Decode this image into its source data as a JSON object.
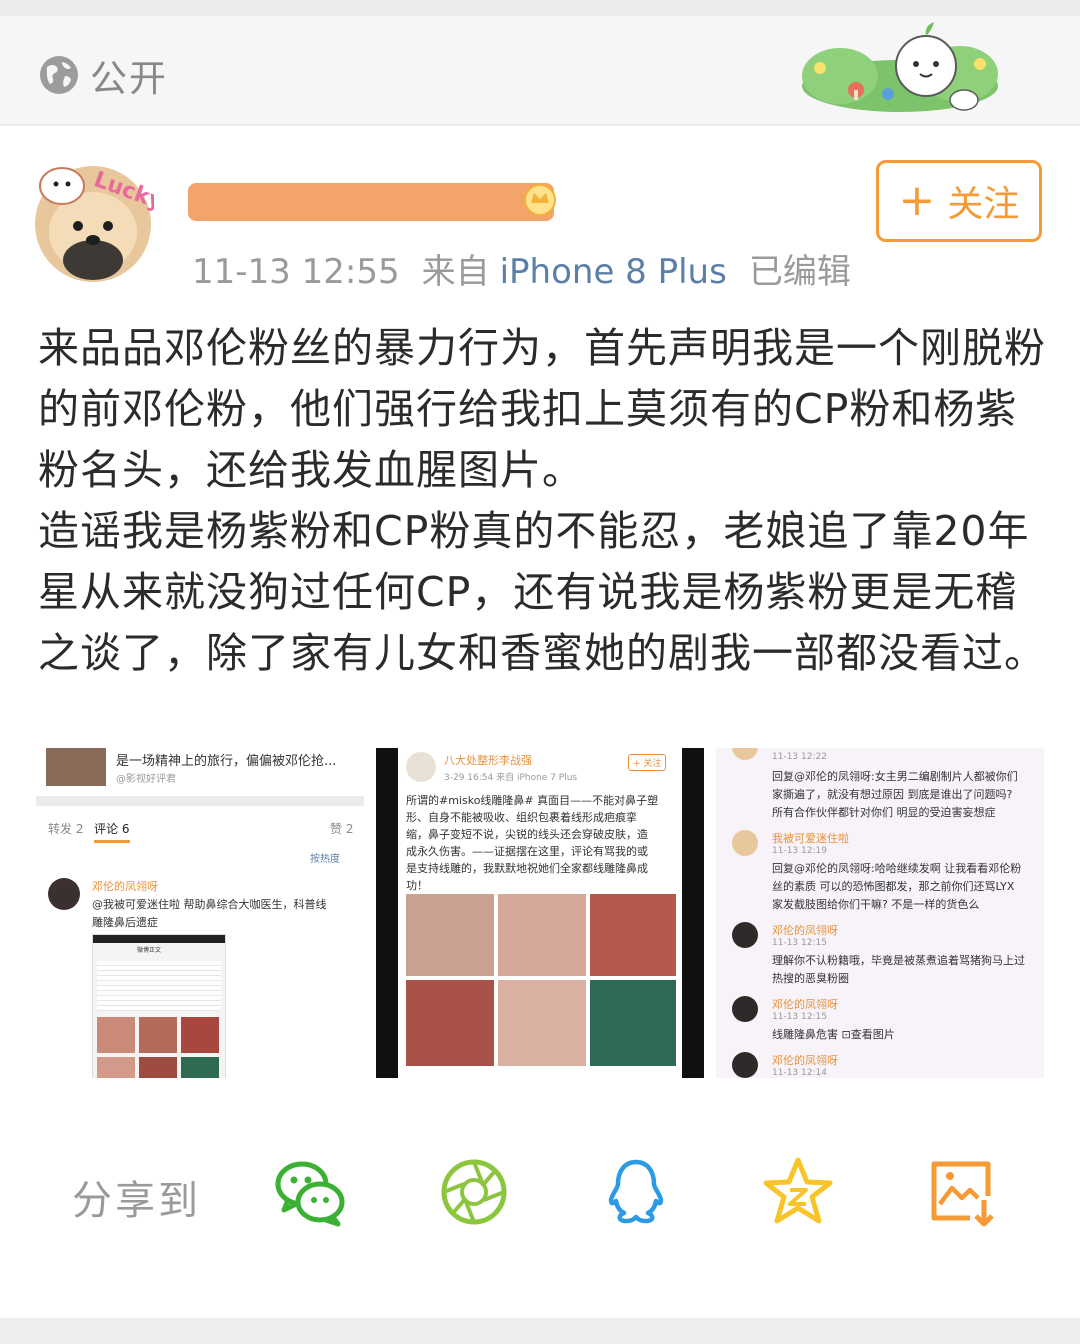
{
  "visibility": {
    "label": "公开",
    "icon": "globe-icon"
  },
  "post": {
    "timestamp": "11-13 12:55",
    "source_prefix": "来自",
    "device": "iPhone 8 Plus",
    "edited": "已编辑",
    "follow_label": "关注",
    "paragraphs": [
      "来品品邓伦粉丝的暴力行为，首先声明我是一个刚脱粉的前邓伦粉，他们强行给我扣上莫须有的CP粉和杨紫粉名头，还给我发血腥图片。",
      "造谣我是杨紫粉和CP粉真的不能忍，老娘追了靠20年星从来就没狗过任何CP，还有说我是杨紫粉更是无稽之谈了，除了家有儿女和香蜜她的剧我一部都没看过。"
    ],
    "avatar_text": "Lucky"
  },
  "image1": {
    "headline": "是一场精神上的旅行，偏偏被邓伦抢...",
    "sub": "@影视好评君",
    "tabs": [
      "转发 2",
      "评论 6",
      "赞 2"
    ],
    "sort": "按热度",
    "commenter": "邓伦的凤翎呀",
    "comment": [
      "@我被可爱迷住啦  帮助鼻综合大咖医生，科普线",
      "雕隆鼻后遗症"
    ],
    "nested_title": "微博正文"
  },
  "image2": {
    "user": "八大处整形李战强",
    "meta": "3-29 16:54  来自 iPhone 7 Plus",
    "follow": "+ 关注",
    "text": [
      "所谓的#misko线雕隆鼻# 真面目——不能对鼻子塑",
      "形、自身不能被吸收、组织包裹着线形成疤痕挛",
      "缩，鼻子变短不说，尖锐的线头还会穿破皮肤，造",
      "成永久伤害。——证据摆在这里，评论有骂我的或",
      "是支持线雕的，我默默地祝她们全家都线雕隆鼻成",
      "功！"
    ]
  },
  "image3": {
    "comments": [
      {
        "name": "",
        "time": "11-13 12:22",
        "lines": [
          "回复@邓伦的凤翎呀:女主男二编剧制片人都被你们",
          "家撕遍了，就没有想过原因 到底是谁出了问题吗?",
          "所有合作伙伴都针对你们 明显的受迫害妄想症"
        ]
      },
      {
        "name": "我被可爱迷住啦",
        "time": "11-13 12:19",
        "lines": [
          "回复@邓伦的凤翎呀:哈哈继续发啊 让我看看邓伦粉",
          "丝的素质 可以的恐怖图都发，那之前你们还骂LYX",
          "家发截肢图给你们干嘛? 不是一样的货色么"
        ]
      },
      {
        "name": "邓伦的凤翎呀",
        "time": "11-13 12:15",
        "lines": [
          "理解你不认粉籍哦，毕竟是被蒸煮追着骂猪狗马上过",
          "热搜的恶臭粉圈"
        ]
      },
      {
        "name": "邓伦的凤翎呀",
        "time": "11-13 12:15",
        "lines": [
          "线雕隆鼻危害 ⊡查看图片"
        ]
      },
      {
        "name": "邓伦的凤翎呀",
        "time": "11-13 12:14",
        "lines": []
      }
    ]
  },
  "share": {
    "label": "分享到",
    "targets": [
      "wechat-icon",
      "moments-icon",
      "qq-icon",
      "qzone-icon",
      "save-image-icon"
    ]
  },
  "colors": {
    "accent": "#f59a35",
    "link": "#5b7fa8",
    "wechat": "#3cb034",
    "moments": "#8cc63e",
    "qq": "#2c9be4",
    "qzone": "#f7c52a",
    "save": "#f59a35"
  }
}
